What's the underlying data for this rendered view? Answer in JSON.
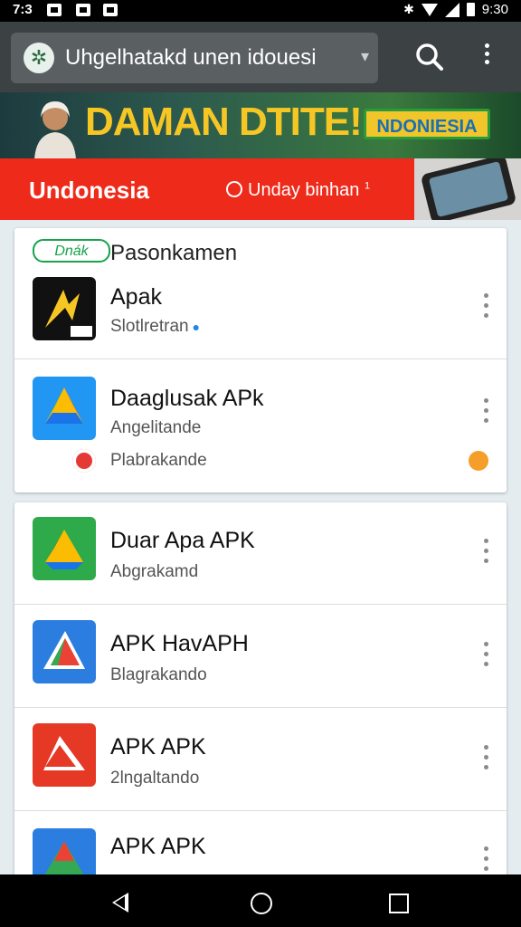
{
  "status_bar": {
    "time_left": "7:3",
    "time_right": "9:30"
  },
  "app_bar": {
    "search_text": "Uhgelhatakd unen idouesi"
  },
  "banner_top": {
    "headline": "DAMAN DTITE!",
    "badge": "NDONIESIA"
  },
  "banner_red": {
    "brand": "Undonesia",
    "promo": "Unday binhan"
  },
  "section1": {
    "tag": "Dnák",
    "title": "Pasonkamen",
    "rows": [
      {
        "title": "Apak",
        "subtitle": "Slotlretran",
        "icon_name": "yellow-lightning-app-icon"
      },
      {
        "title": "Daaglusak APk",
        "subtitle": "Angelitande",
        "extra": "Plabrakande",
        "icon_name": "blue-drive-app-icon"
      }
    ]
  },
  "section2": {
    "rows": [
      {
        "title": "Duar Apa APK",
        "subtitle": "Abgrakamd",
        "icon_name": "green-drive-app-icon"
      },
      {
        "title": "APK HavAPH",
        "subtitle": "Blagrakando",
        "icon_name": "blue-triangle-app-icon"
      },
      {
        "title": "APK APK",
        "subtitle": "2lngaltando",
        "icon_name": "red-triangle-app-icon"
      },
      {
        "title": "APK APK",
        "subtitle": "",
        "icon_name": "blue-green-app-icon"
      }
    ]
  },
  "colors": {
    "brand_red": "#ee2a1a",
    "appbar": "#3c4144",
    "accent_green": "#16a34a",
    "banner_yellow": "#f6c624"
  }
}
